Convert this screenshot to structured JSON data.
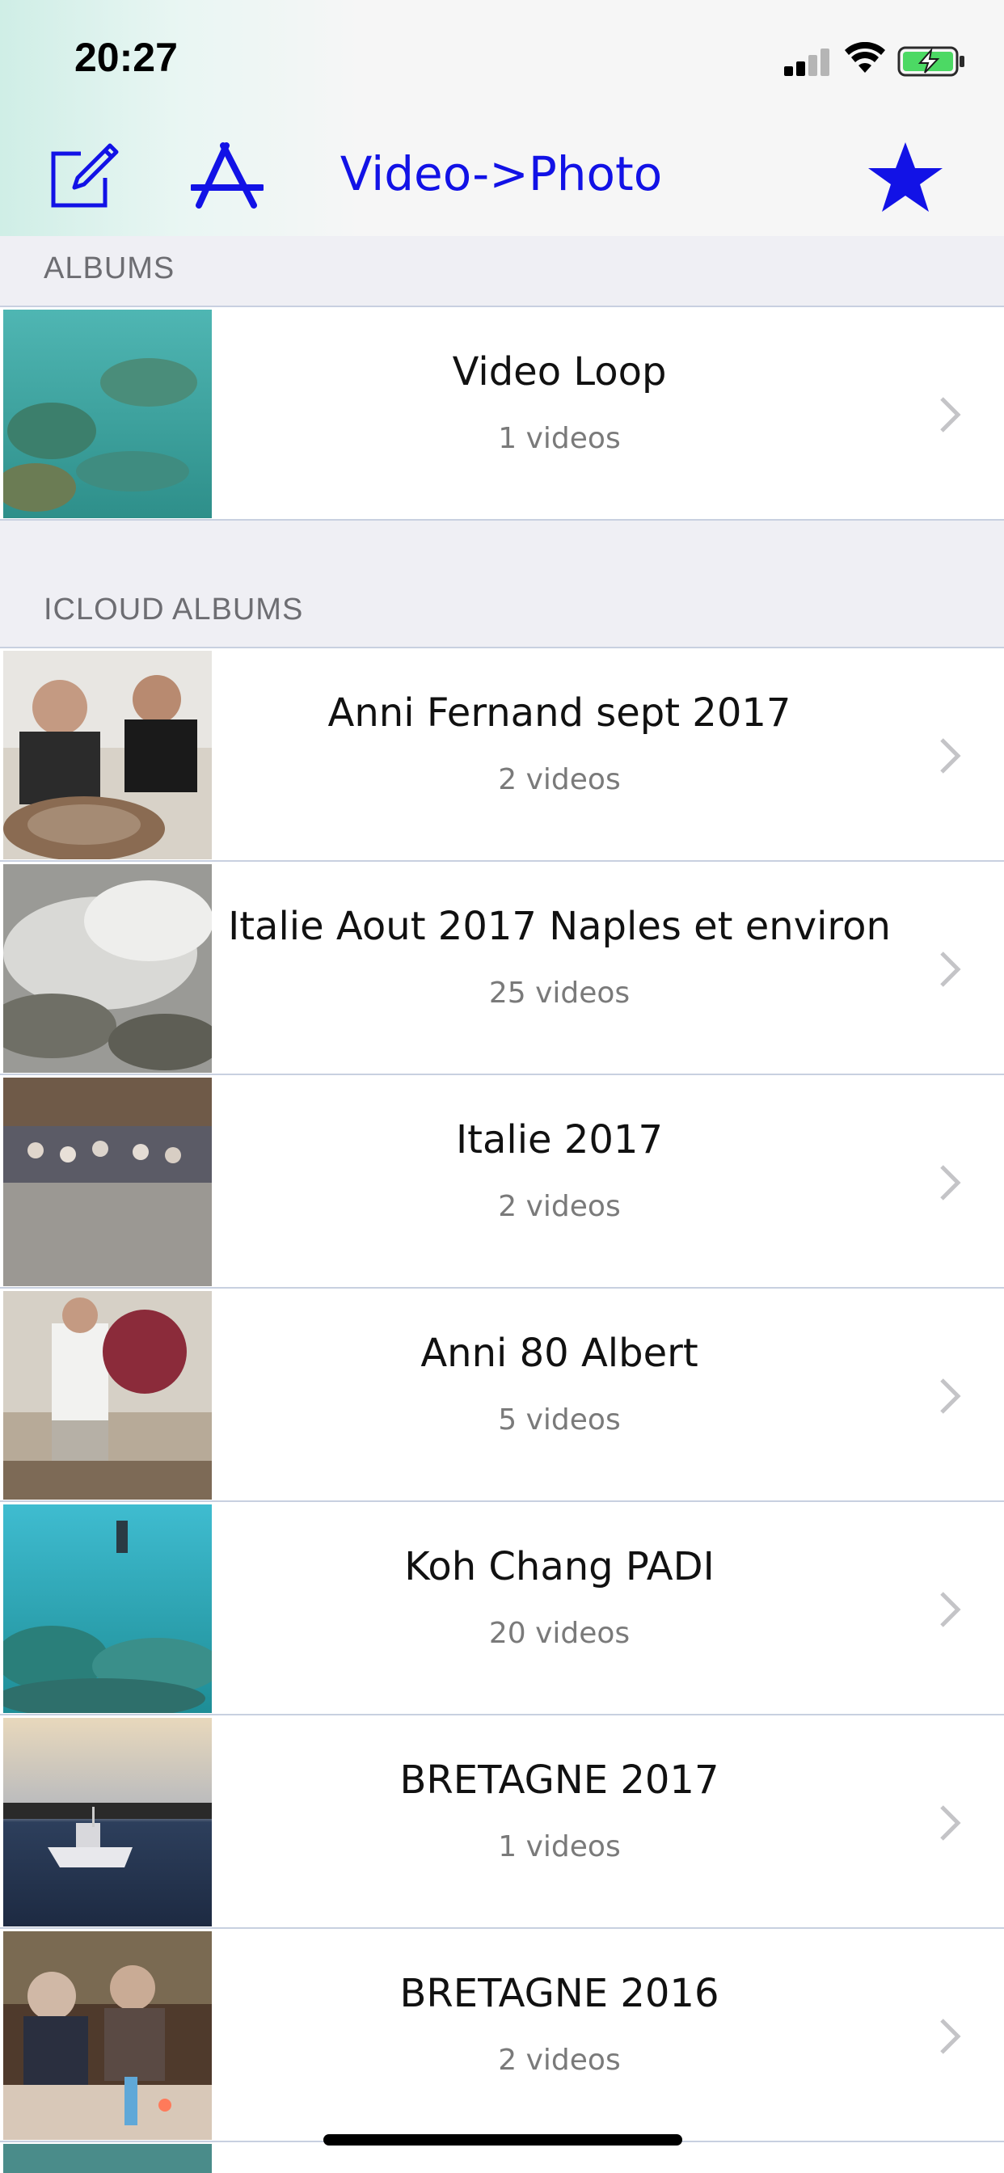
{
  "status_bar": {
    "time": "20:27"
  },
  "nav": {
    "title": "Video->Photo",
    "accent_color": "#1212e6",
    "left_icons": [
      "compose-icon",
      "app-store-icon"
    ],
    "right_icon": "star-icon"
  },
  "sections": [
    {
      "header": "ALBUMS"
    },
    {
      "header": "ICLOUD ALBUMS"
    }
  ],
  "albums": [
    {
      "title": "Video Loop",
      "count": "1 videos",
      "thumb": "underwater coral reef"
    },
    {
      "title": "Anni Fernand sept 2017",
      "count": "2 videos",
      "thumb": "people at table with pottery"
    },
    {
      "title": "Italie Aout 2017 Naples et environ",
      "count": "25 videos",
      "thumb": "steam over rocks"
    },
    {
      "title": "Italie 2017",
      "count": "2 videos",
      "thumb": "crowd in town square"
    },
    {
      "title": "Anni 80 Albert",
      "count": "5 videos",
      "thumb": "man with 80 balloon"
    },
    {
      "title": "Koh Chang PADI",
      "count": "20 videos",
      "thumb": "divers underwater"
    },
    {
      "title": "BRETAGNE 2017",
      "count": "1 videos",
      "thumb": "boat at sea at dusk"
    },
    {
      "title": "BRETAGNE 2016",
      "count": "2 videos",
      "thumb": "family dinner with candles"
    }
  ]
}
